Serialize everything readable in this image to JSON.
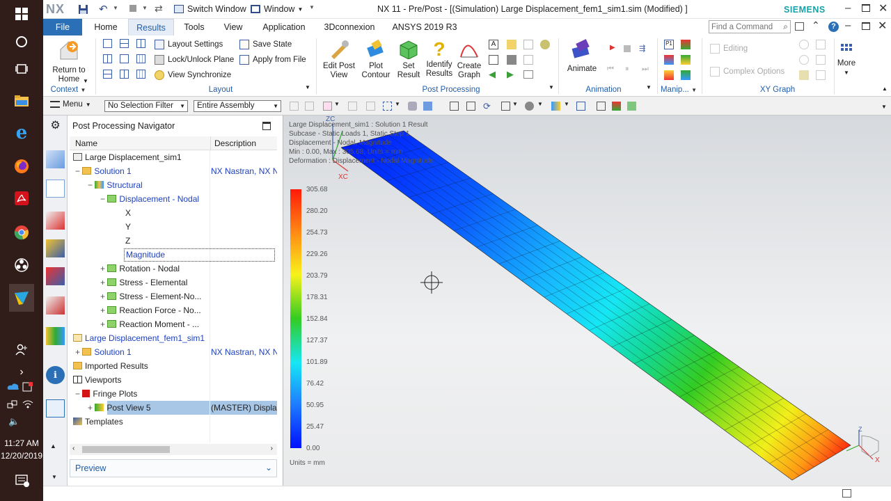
{
  "taskbar": {
    "time": "11:27 AM",
    "date": "12/20/2019"
  },
  "title": {
    "logo": "NX",
    "switch_window": "Switch Window",
    "window_menu": "Window",
    "text": "NX 11 - Pre/Post - [(Simulation) Large Displacement_fem1_sim1.sim (Modified) ]",
    "brand": "SIEMENS"
  },
  "tabs": [
    "File",
    "Home",
    "Results",
    "Tools",
    "View",
    "Application",
    "3Dconnexion",
    "ANSYS 2019 R3"
  ],
  "command_finder": {
    "placeholder": "Find a Command"
  },
  "ribbon": {
    "return_home": "Return to Home",
    "context": "Context",
    "layout_settings": "Layout Settings",
    "lock_unlock_plane": "Lock/Unlock Plane",
    "view_synchronize": "View Synchronize",
    "save_state": "Save State",
    "apply_from_file": "Apply from File",
    "layout": "Layout",
    "edit_post_view": "Edit Post View",
    "plot_contour": "Plot Contour",
    "set_result": "Set Result",
    "identify_results": "Identify Results",
    "create_graph": "Create Graph",
    "post_processing": "Post Processing",
    "animate": "Animate",
    "animation": "Animation",
    "manip": "Manip...",
    "editing": "Editing",
    "complex_options": "Complex Options",
    "more": "More",
    "xy_graph": "XY Graph"
  },
  "filterbar": {
    "menu": "Menu",
    "selection_filter": "No Selection Filter",
    "scope": "Entire Assembly"
  },
  "navigator": {
    "title": "Post Processing Navigator",
    "col_name": "Name",
    "col_desc": "Description",
    "rows": [
      {
        "label": "Large Displacement_sim1",
        "desc": ""
      },
      {
        "label": "Solution 1",
        "desc": "NX Nastran, NX N"
      },
      {
        "label": "Structural",
        "desc": ""
      },
      {
        "label": "Displacement - Nodal",
        "desc": ""
      },
      {
        "label": "X",
        "desc": ""
      },
      {
        "label": "Y",
        "desc": ""
      },
      {
        "label": "Z",
        "desc": ""
      },
      {
        "label": "Magnitude",
        "desc": ""
      },
      {
        "label": "Rotation - Nodal",
        "desc": ""
      },
      {
        "label": "Stress - Elemental",
        "desc": ""
      },
      {
        "label": "Stress - Element-No...",
        "desc": ""
      },
      {
        "label": "Reaction Force - No...",
        "desc": ""
      },
      {
        "label": "Reaction Moment - ...",
        "desc": ""
      },
      {
        "label": "Large Displacement_fem1_sim1",
        "desc": ""
      },
      {
        "label": "Solution 1",
        "desc": "NX Nastran, NX N"
      },
      {
        "label": "Imported Results",
        "desc": ""
      },
      {
        "label": "Viewports",
        "desc": ""
      },
      {
        "label": "Fringe Plots",
        "desc": ""
      },
      {
        "label": "Post View 5",
        "desc": "(MASTER) Displa"
      },
      {
        "label": "Templates",
        "desc": ""
      }
    ],
    "preview": "Preview"
  },
  "viewport": {
    "info": [
      "Large Displacement_sim1 : Solution 1 Result",
      "Subcase - Static Loads 1, Static Step 1",
      "Displacement - Nodal, Magnitude",
      "Min : 0.00, Max : 305.68, Units = mm",
      "Deformation : Displacement - Nodal Magnitude"
    ],
    "axis_zc": "ZC",
    "axis_xc": "XC",
    "legend_values": [
      "305.68",
      "280.20",
      "254.73",
      "229.26",
      "203.79",
      "178.31",
      "152.84",
      "127.37",
      "101.89",
      "76.42",
      "50.95",
      "25.47",
      "0.00"
    ],
    "units": "Units = mm",
    "triad_z": "Z",
    "triad_x": "X"
  }
}
